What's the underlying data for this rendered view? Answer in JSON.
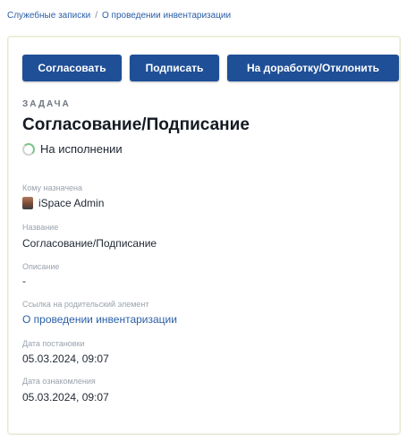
{
  "breadcrumb": {
    "parent": "Служебные записки",
    "separator": "/",
    "current": "О проведении инвентаризации"
  },
  "toolbar": {
    "approve_label": "Согласовать",
    "sign_label": "Подписать",
    "reject_label": "На доработку/Отклонить"
  },
  "task": {
    "kicker": "ЗАДАЧА",
    "title": "Согласование/Подписание",
    "status": "На исполнении",
    "status_icon": "progress-ring-icon"
  },
  "fields": {
    "assignee": {
      "label": "Кому назначена",
      "value": "iSpace Admin",
      "icon": "avatar-icon"
    },
    "name": {
      "label": "Название",
      "value": "Согласование/Подписание"
    },
    "description": {
      "label": "Описание",
      "value": "-"
    },
    "parent_link": {
      "label": "Ссылка на родительский элемент",
      "value": "О проведении инвентаризации"
    },
    "posted_date": {
      "label": "Дата постановки",
      "value": "05.03.2024, 09:07"
    },
    "viewed_date": {
      "label": "Дата ознакомления",
      "value": "05.03.2024, 09:07"
    }
  },
  "colors": {
    "button": "#1f4f96",
    "link": "#2a5ea8",
    "status_ring": "#7cc48a"
  }
}
